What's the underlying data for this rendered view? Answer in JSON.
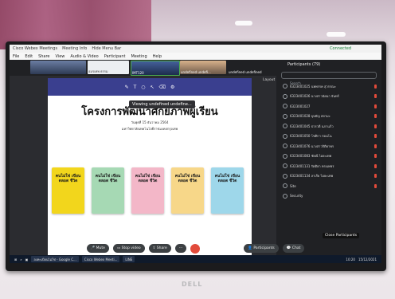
{
  "window": {
    "titlebar_items": [
      "Cisco Webex Meetings",
      "Meeting Info",
      "Hide Menu Bar"
    ],
    "connected_label": "Connected"
  },
  "menu": [
    "File",
    "Edit",
    "Share",
    "View",
    "Audio & Video",
    "Participant",
    "Meeting",
    "Help"
  ],
  "video_tiles": [
    {
      "label": ""
    },
    {
      "label": "อมรเทพ ธรรม"
    },
    {
      "label": "IMT120"
    },
    {
      "label": "undefined undefi..."
    },
    {
      "label": "undefined undefined"
    }
  ],
  "layout_label": "Layout",
  "viewing_label": "Viewing undefined undefine...",
  "slide": {
    "title": "โครงการพัฒนาศักยภาพผู้เรียน",
    "date_line": "วันพุธที่ 15 ธันวาคม 2564",
    "org_line": "มหาวิทยาลัยเทคโนโลยีราชมงคลกรุงเทพ",
    "books": [
      {
        "text": "คนไม่ใช่ เขียนตลอด ชีวิต",
        "color": "#f2d61c"
      },
      {
        "text": "คนไม่ใช่ เขียนตลอด ชีวิต",
        "color": "#a6d9b4"
      },
      {
        "text": "คนไม่ใช่ เขียนตลอด ชีวิต",
        "color": "#f3b7c8"
      },
      {
        "text": "คนไม่ใช่ เขียนตลอด ชีวิต",
        "color": "#f7d789"
      },
      {
        "text": "คนไม่ใช่ เขียนตลอด ชีวิต",
        "color": "#9ed7ea"
      }
    ]
  },
  "participants_panel": {
    "header": "Participants (79)",
    "search_placeholder": "Search",
    "items": [
      "6323401025 นพพรรค สุวรรณะ",
      "6323401026 นางสาวนัยนา จันทร์",
      "6323001027",
      "6323401028 บุษยัญ สยามะ",
      "6323401045 ปวรวดี นภาแก้ว",
      "6323401050 โชติกา ก่อนโน",
      "6323401076 นางสาวกิติยาพร",
      "6323401083 ชัยณี ไอยะเทพ",
      "6323401131 รัตติยา ทรงเพชร",
      "6323401134 ลาเรีย ไอยะเทพ",
      "Site",
      "Security"
    ]
  },
  "controls": {
    "mute": "Mute",
    "stop_video": "Stop video",
    "share": "Share",
    "participants": "Participants",
    "chat": "Chat",
    "tooltip": "Close Participants"
  },
  "taskbar": {
    "items": [
      "ลงทะเบียนไม่ใช่ - Google C...",
      "Cisco Webex Meeti...",
      "LINE"
    ],
    "time": "10:20",
    "date": "15/12/2021"
  },
  "monitor_brand": "DELL",
  "colors": {
    "panel_bg": "#202124",
    "toolbar": "#3a3f8f",
    "end_button": "#e24b3b"
  }
}
